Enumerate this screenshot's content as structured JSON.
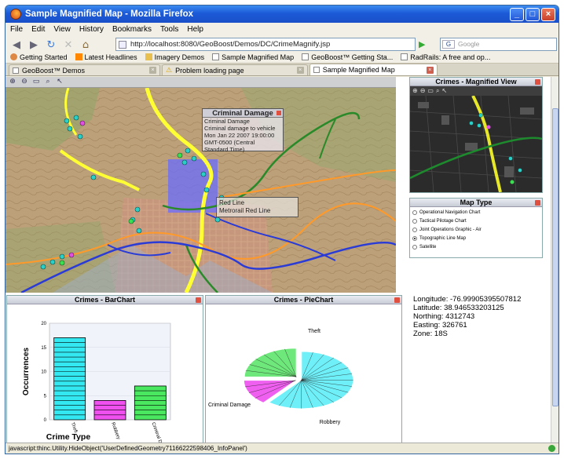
{
  "window": {
    "title": "Sample Magnified Map - Mozilla Firefox"
  },
  "menu": [
    "File",
    "Edit",
    "View",
    "History",
    "Bookmarks",
    "Tools",
    "Help"
  ],
  "nav": {
    "url": "http://localhost:8080/GeoBoost/Demos/DC/CrimeMagnify.jsp",
    "search_placeholder": "Google"
  },
  "bookmarks": [
    "Getting Started",
    "Latest Headlines",
    "Imagery Demos",
    "Sample Magnified Map",
    "GeoBoost™ Getting Sta...",
    "RadRails: A free and op..."
  ],
  "tabs": [
    {
      "label": "GeoBoost™ Demos",
      "active": false
    },
    {
      "label": "Problem loading page",
      "active": false
    },
    {
      "label": "Sample Magnified Map",
      "active": true
    }
  ],
  "map": {
    "popup_title": "Criminal Damage",
    "popup_lines": [
      "Criminal Damage",
      "Criminal damage to vehicle",
      "Mon Jan 22 2007 19:00:00",
      "GMT-0500 (Central",
      "Standard Time)"
    ],
    "line_tip": [
      "Red Line",
      "Metrorail Red Line"
    ]
  },
  "magnified": {
    "title": "Crimes - Magnified View"
  },
  "maptype": {
    "title": "Map Type",
    "options": [
      "Operational Navigation Chart",
      "Tactical Pilotage Chart",
      "Joint Operations Graphic - Air",
      "Topographic Line Map",
      "Satellite"
    ],
    "selected": 3
  },
  "coords": {
    "longitude": "Longitude: -76.99905395507812",
    "latitude": "Latitude: 38.946533203125",
    "northing": "Northing: 4312743",
    "easting": "Easting: 326761",
    "zone": "Zone: 18S"
  },
  "barchart": {
    "title": "Crimes - BarChart"
  },
  "piechart": {
    "title": "Crimes - PieChart"
  },
  "chart_data": [
    {
      "type": "bar",
      "categories": [
        "Theft",
        "Robbery",
        "Criminal Da"
      ],
      "values": [
        17,
        4,
        7
      ],
      "ylabel": "Occurrences",
      "xlabel": "Crime Type",
      "ylim": [
        0,
        20
      ],
      "yticks": [
        0,
        5,
        10,
        15,
        20
      ],
      "colors": [
        "#33e8f0",
        "#f050f0",
        "#4ae860"
      ]
    },
    {
      "type": "pie",
      "labels": [
        "Theft",
        "Robbery",
        "Criminal Damage"
      ],
      "values": [
        17,
        4,
        7
      ],
      "colors": [
        "#6ff0f8",
        "#f060f0",
        "#6ee87a"
      ]
    }
  ],
  "status": "javascript:thinc.Utility.HideObject('UserDefinedGeometry71166222598406_InfoPanel')"
}
